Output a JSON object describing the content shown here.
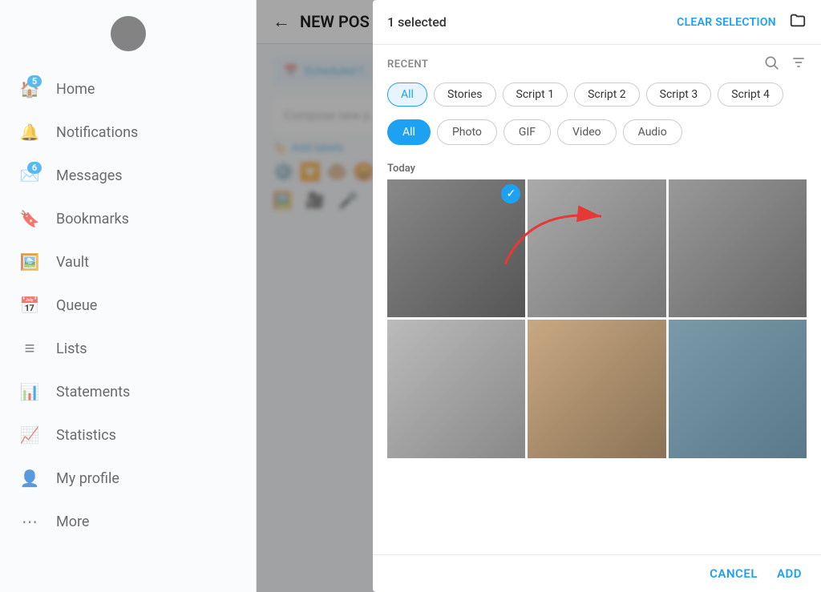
{
  "sidebar": {
    "items": [
      {
        "id": "home",
        "label": "Home",
        "icon": "🏠",
        "badge": "5"
      },
      {
        "id": "notifications",
        "label": "Notifications",
        "icon": "🔔",
        "badge": null
      },
      {
        "id": "messages",
        "label": "Messages",
        "icon": "✉️",
        "badge": "6"
      },
      {
        "id": "bookmarks",
        "label": "Bookmarks",
        "icon": "🔖",
        "badge": null
      },
      {
        "id": "vault",
        "label": "Vault",
        "icon": "🖼️",
        "badge": null
      },
      {
        "id": "queue",
        "label": "Queue",
        "icon": "📅",
        "badge": null
      },
      {
        "id": "lists",
        "label": "Lists",
        "icon": "≡",
        "badge": null
      },
      {
        "id": "statements",
        "label": "Statements",
        "icon": "📊",
        "badge": null
      },
      {
        "id": "statistics",
        "label": "Statistics",
        "icon": "📈",
        "badge": null
      },
      {
        "id": "my-profile",
        "label": "My profile",
        "icon": "👤",
        "badge": null
      },
      {
        "id": "more",
        "label": "More",
        "icon": "⋯",
        "badge": null
      }
    ]
  },
  "header": {
    "back_label": "←",
    "title": "NEW POS selected"
  },
  "content": {
    "scheduled_text": "Scheduled f...",
    "compose_placeholder": "Compose new p...",
    "add_labels": "Add labels"
  },
  "dialog": {
    "selected_count": "1 selected",
    "clear_selection_label": "CLEAR SELECTION",
    "recent_label": "RECENT",
    "script_tabs": [
      {
        "label": "All",
        "active": true
      },
      {
        "label": "Stories",
        "active": false
      },
      {
        "label": "Script 1",
        "active": false
      },
      {
        "label": "Script 2",
        "active": false
      },
      {
        "label": "Script 3",
        "active": false
      },
      {
        "label": "Script 4",
        "active": false
      }
    ],
    "type_tabs": [
      {
        "label": "All",
        "active": true
      },
      {
        "label": "Photo",
        "active": false
      },
      {
        "label": "GIF",
        "active": false
      },
      {
        "label": "Video",
        "active": false
      },
      {
        "label": "Audio",
        "active": false
      }
    ],
    "date_section": "Today",
    "cancel_label": "CANCEL",
    "add_label": "ADD"
  }
}
